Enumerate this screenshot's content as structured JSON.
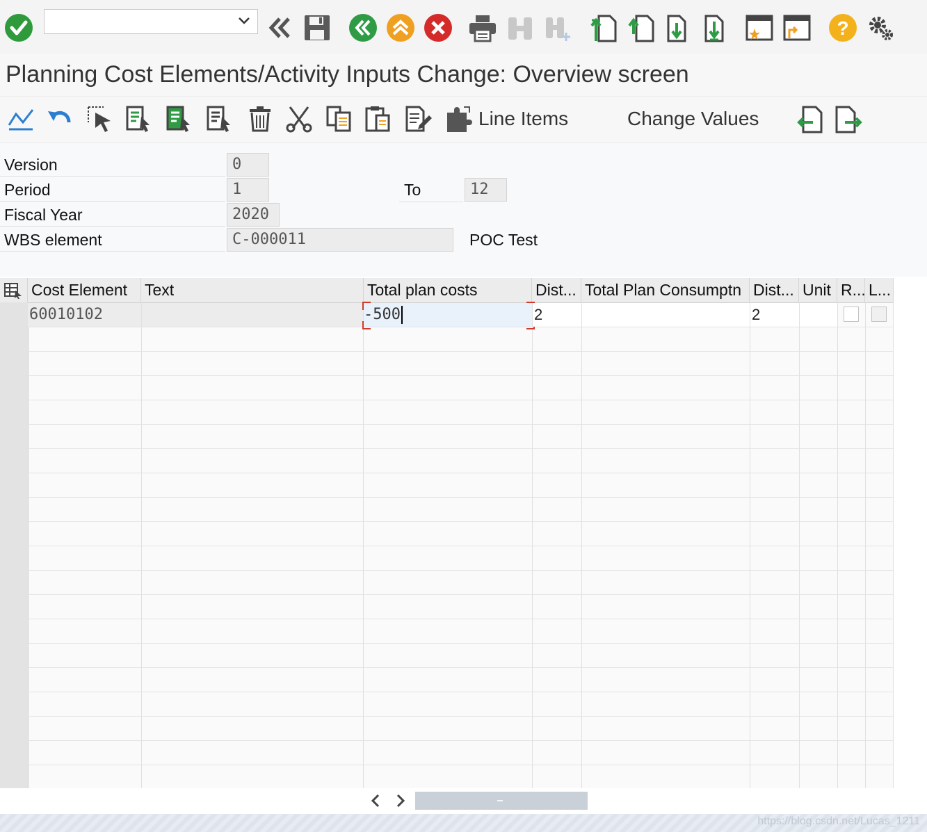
{
  "system_toolbar": {
    "command_field_value": ""
  },
  "title": "Planning Cost Elements/Activity Inputs Change: Overview screen",
  "app_toolbar": {
    "line_items_label": "Line Items",
    "change_values_label": "Change Values"
  },
  "header": {
    "version_label": "Version",
    "version_value": "0",
    "period_label": "Period",
    "period_from": "1",
    "period_to_label": "To",
    "period_to": "12",
    "fiscal_year_label": "Fiscal Year",
    "fiscal_year_value": "2020",
    "wbs_label": "WBS element",
    "wbs_value": "C-000011",
    "wbs_description": "POC Test"
  },
  "table": {
    "columns": [
      "Cost Element",
      "Text",
      "Total plan costs",
      "Dist...",
      "Total Plan Consumptn",
      "Dist...",
      "Unit",
      "R...",
      "L..."
    ],
    "rows": [
      {
        "cost_element": "60010102",
        "text": "",
        "total_plan_costs": "-500",
        "dist1": "2",
        "total_plan_consumptn": "",
        "dist2": "2",
        "unit": "",
        "r_checked": false,
        "l_checked": false
      }
    ]
  },
  "footer": {
    "watermark": "https://blog.csdn.net/Lucas_1211"
  },
  "colors": {
    "check_green": "#2e9a3c",
    "nav_green": "#2f9b45",
    "nav_orange": "#f0a020",
    "cancel_red": "#d42a2a",
    "help_yellow": "#f3b21c",
    "focus_red": "#d23a2a"
  }
}
